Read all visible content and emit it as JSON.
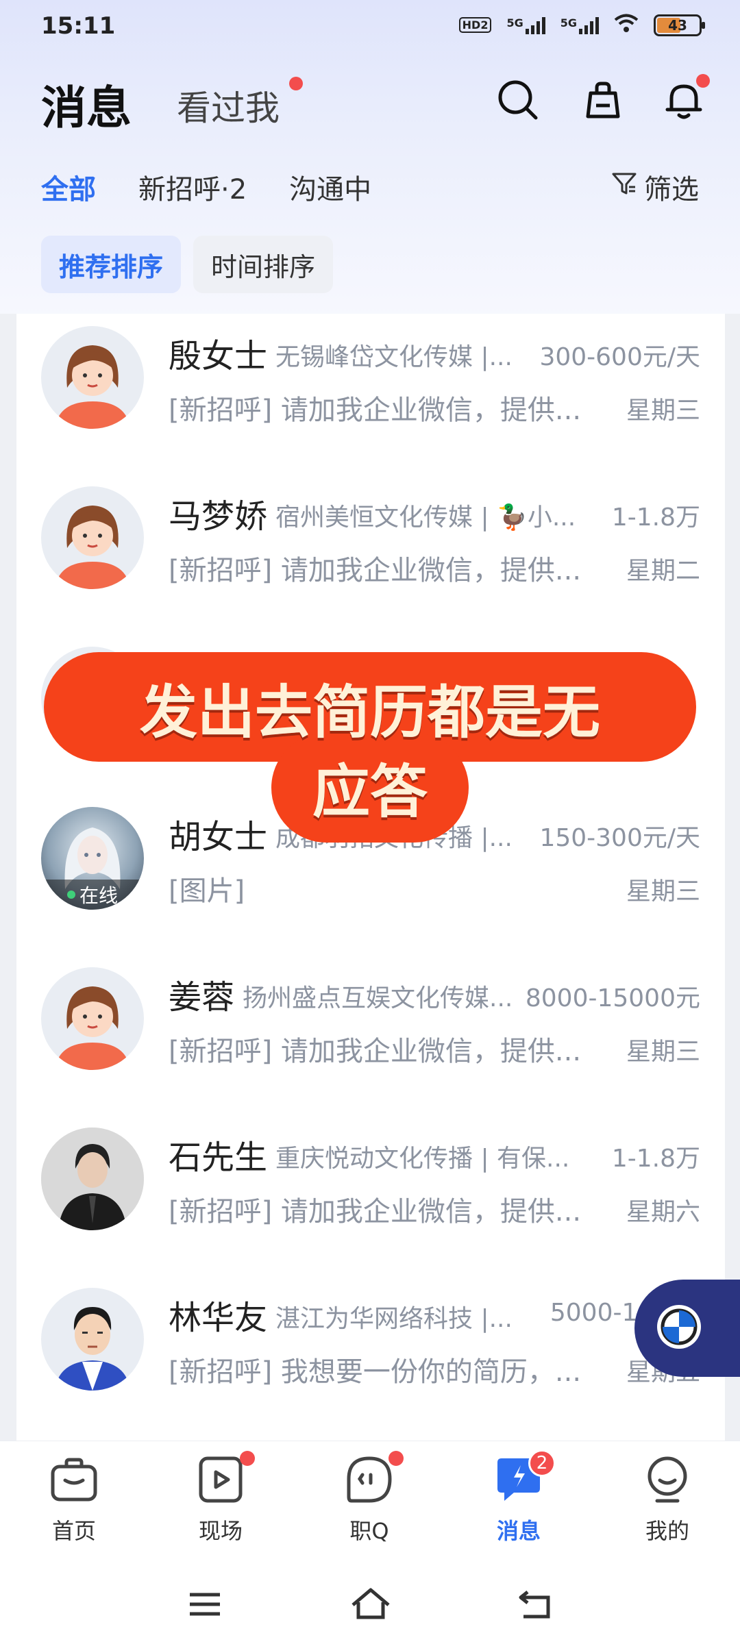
{
  "status_bar": {
    "time": "15:11",
    "hd_label": "HD2",
    "sim1": "5G",
    "sim2": "5G",
    "battery": "43"
  },
  "header": {
    "title": "消息",
    "seen_me": "看过我",
    "icons": [
      "search-icon",
      "briefcase-icon",
      "bell-icon"
    ]
  },
  "tabs": [
    {
      "label": "全部",
      "active": true
    },
    {
      "label": "新招呼·2",
      "active": false
    },
    {
      "label": "沟通中",
      "active": false
    }
  ],
  "filter_label": "筛选",
  "sort": [
    {
      "label": "推荐排序",
      "active": true
    },
    {
      "label": "时间排序",
      "active": false
    }
  ],
  "messages": [
    {
      "name": "殷女士",
      "company": "无锡峰岱文化传媒 |...",
      "salary": "300-600元/天",
      "message": "[新招呼] 请加我企业微信，提供...",
      "day": "星期三",
      "avatar": "cartoon-woman"
    },
    {
      "name": "马梦娇",
      "company": "宿州美恒文化传媒 | 🦆小...",
      "salary": "1-1.8万",
      "message": "[新招呼] 请加我企业微信，提供...",
      "day": "星期二",
      "avatar": "cartoon-woman"
    },
    {
      "name": "胡女士",
      "company": "成都羽拓文化传播 |...",
      "salary": "150-300元/天",
      "message": "[图片]",
      "day": "星期三",
      "avatar": "anime-girl",
      "online": "在线"
    },
    {
      "name": "姜蓉",
      "company": "扬州盛点互娱文化传媒...",
      "salary": "8000-15000元",
      "message": "[新招呼] 请加我企业微信，提供...",
      "day": "星期三",
      "avatar": "cartoon-woman"
    },
    {
      "name": "石先生",
      "company": "重庆悦动文化传播 | 有保...",
      "salary": "1-1.8万",
      "message": "[新招呼] 请加我企业微信，提供...",
      "day": "星期六",
      "avatar": "photo-man"
    },
    {
      "name": "林华友",
      "company": "湛江为华网络科技 |...",
      "salary": "5000-10000",
      "message": "[新招呼] 我想要一份你的简历，...",
      "day": "星期五",
      "avatar": "cartoon-man"
    }
  ],
  "caption": {
    "line1": "发出去简历都是无",
    "line2": "应答"
  },
  "bottom_nav": [
    {
      "label": "首页",
      "icon": "home-bag-icon"
    },
    {
      "label": "现场",
      "icon": "play-icon",
      "dot": true
    },
    {
      "label": "职Q",
      "icon": "chat-face-icon",
      "dot": true
    },
    {
      "label": "消息",
      "icon": "message-icon",
      "badge": "2",
      "active": true
    },
    {
      "label": "我的",
      "icon": "profile-icon"
    }
  ],
  "colors": {
    "accent": "#2f6ff0",
    "badge": "#f34d4d",
    "caption_bg": "#f5421a"
  }
}
